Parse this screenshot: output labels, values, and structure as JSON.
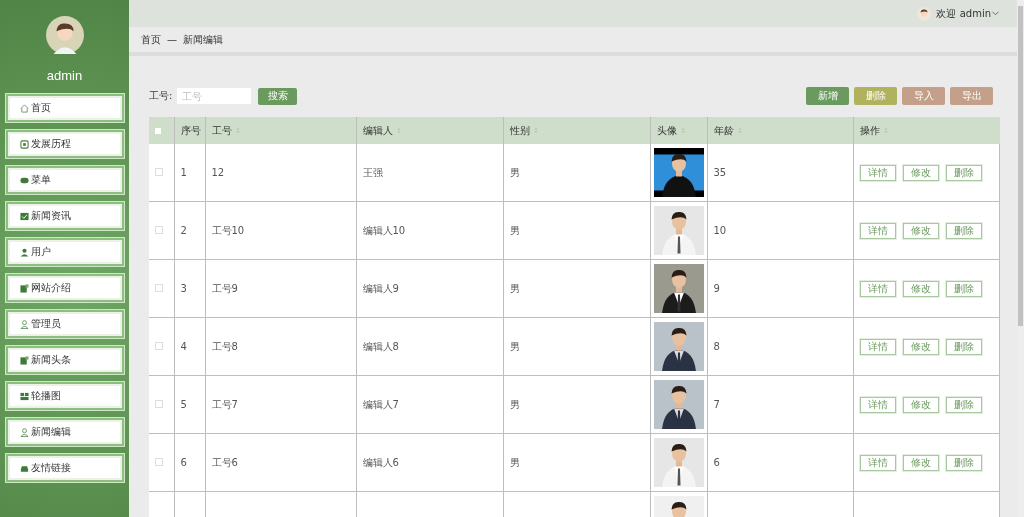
{
  "sidebar": {
    "username": "admin",
    "items": [
      {
        "label": "首页"
      },
      {
        "label": "发展历程"
      },
      {
        "label": "菜单"
      },
      {
        "label": "新闻资讯"
      },
      {
        "label": "用户"
      },
      {
        "label": "网站介绍"
      },
      {
        "label": "管理员"
      },
      {
        "label": "新闻头条"
      },
      {
        "label": "轮播图"
      },
      {
        "label": "新闻编辑"
      },
      {
        "label": "友情链接"
      }
    ]
  },
  "top_bar": {
    "greeting": "欢迎 admin"
  },
  "breadcrumb": [
    "首页",
    "—",
    "新闻编辑"
  ],
  "search": {
    "label": "工号:",
    "placeholder": "工号",
    "button": "搜索"
  },
  "actions": [
    {
      "label": "新增",
      "kind": "add"
    },
    {
      "label": "删除",
      "kind": "delete"
    },
    {
      "label": "导入",
      "kind": "import"
    },
    {
      "label": "导出",
      "kind": "export"
    }
  ],
  "table": {
    "select_all_checked": false,
    "columns": [
      {
        "label": "序号",
        "sortable": false
      },
      {
        "label": "工号",
        "sortable": true
      },
      {
        "label": "编辑人",
        "sortable": true
      },
      {
        "label": "性别",
        "sortable": true
      },
      {
        "label": "头像",
        "sortable": true
      },
      {
        "label": "年龄",
        "sortable": true
      },
      {
        "label": "操作",
        "sortable": true
      }
    ],
    "rows": [
      {
        "kind": "full",
        "checked": false,
        "no": "1",
        "id": "12",
        "editor": "王强",
        "gender": "男",
        "age": "35",
        "buttons": [
          "详情",
          "修改",
          "删除"
        ]
      },
      {
        "kind": "full",
        "checked": false,
        "no": "2",
        "id": "工号10",
        "editor": "编辑人10",
        "gender": "男",
        "age": "10",
        "buttons": [
          "详情",
          "修改",
          "删除"
        ]
      },
      {
        "kind": "full",
        "checked": false,
        "no": "3",
        "id": "工号9",
        "editor": "编辑人9",
        "gender": "男",
        "age": "9",
        "buttons": [
          "详情",
          "修改",
          "删除"
        ]
      },
      {
        "kind": "full",
        "checked": false,
        "no": "4",
        "id": "工号8",
        "editor": "编辑人8",
        "gender": "男",
        "age": "8",
        "buttons": [
          "详情",
          "修改",
          "删除"
        ]
      },
      {
        "kind": "full",
        "checked": false,
        "no": "5",
        "id": "工号7",
        "editor": "编辑人7",
        "gender": "男",
        "age": "7",
        "buttons": [
          "详情",
          "修改",
          "删除"
        ]
      },
      {
        "kind": "full",
        "checked": false,
        "no": "6",
        "id": "工号6",
        "editor": "编辑人6",
        "gender": "男",
        "age": "6",
        "buttons": [
          "详情",
          "修改",
          "删除"
        ]
      },
      {
        "kind": "cut_off"
      }
    ]
  }
}
